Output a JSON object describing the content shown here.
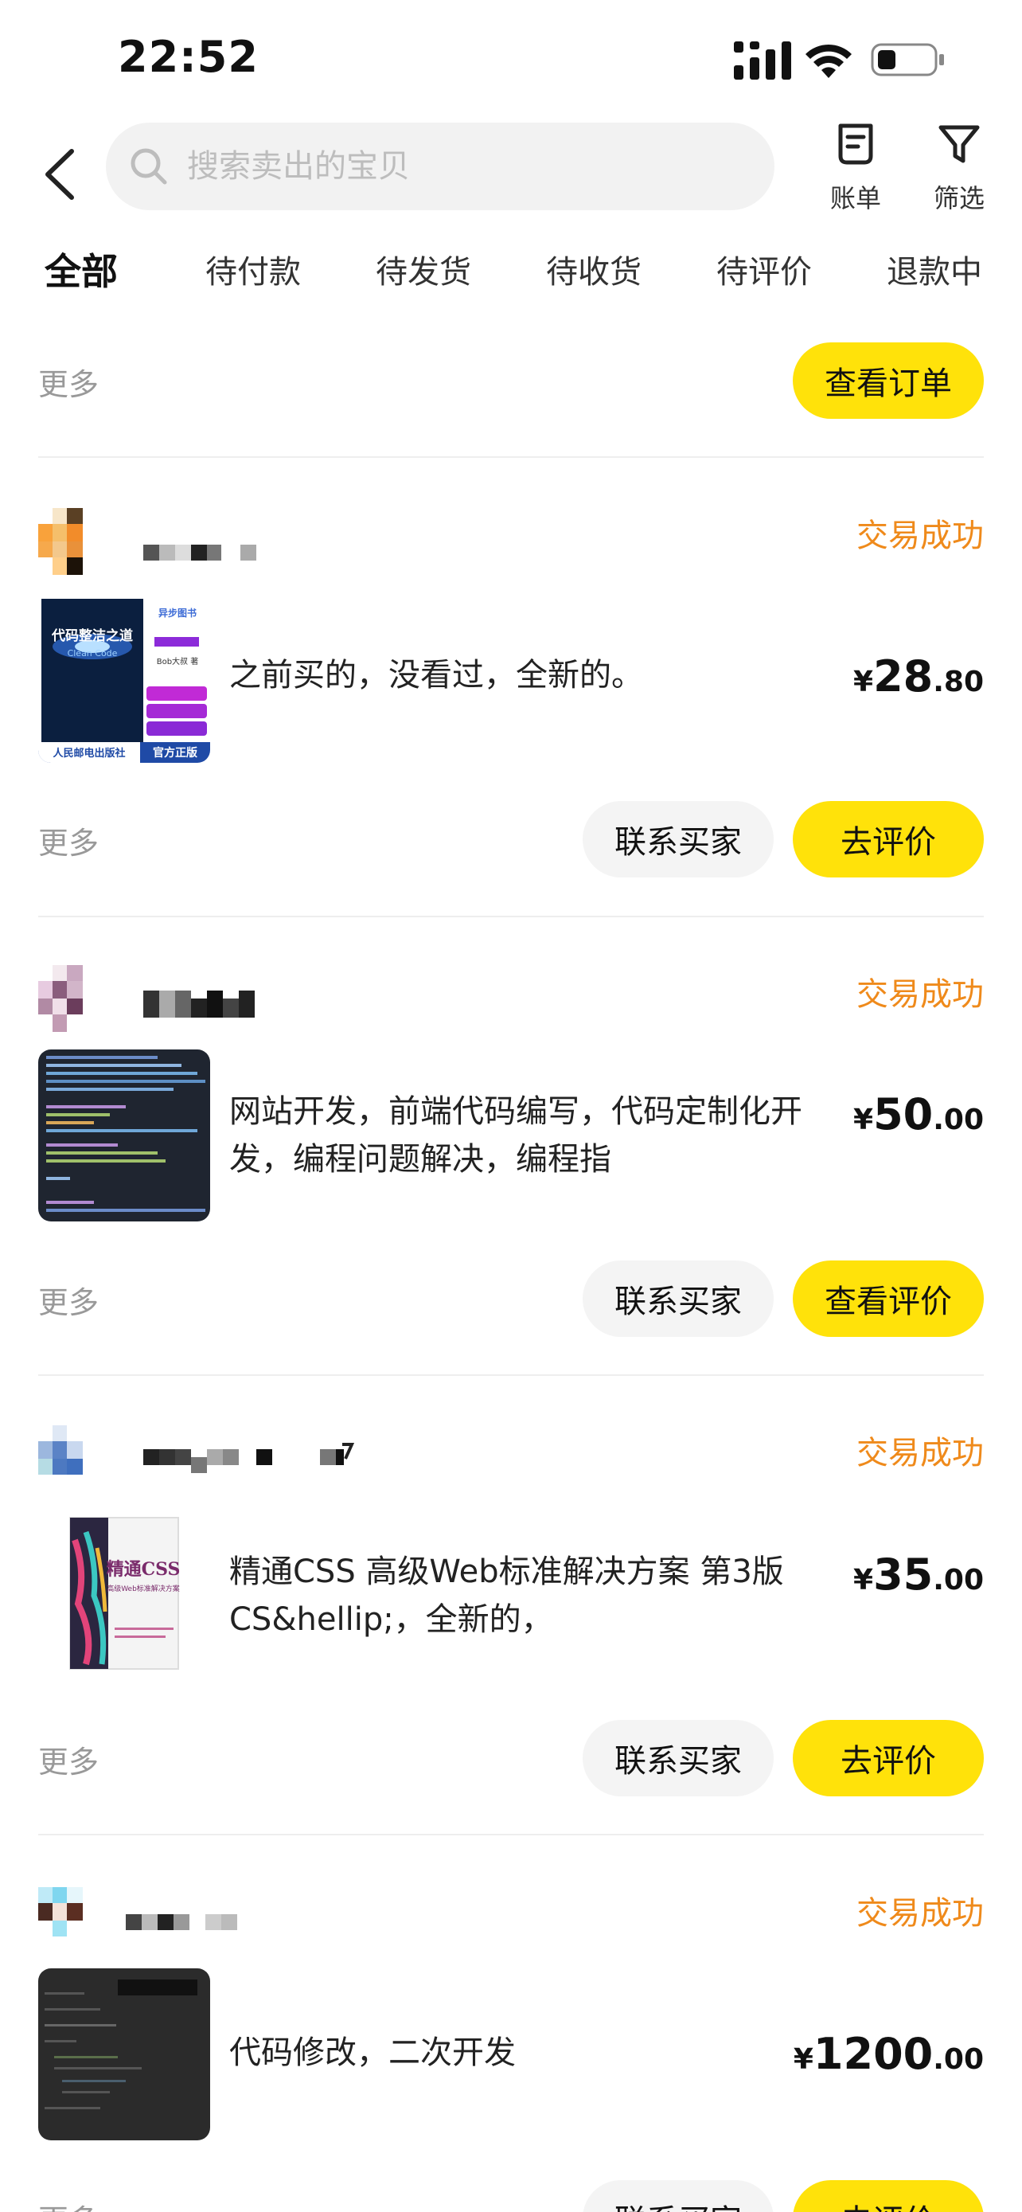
{
  "status_bar": {
    "time": "22:52"
  },
  "header": {
    "search_placeholder": "搜索卖出的宝贝",
    "bill_label": "账单",
    "filter_label": "筛选"
  },
  "tabs": [
    {
      "label": "全部",
      "active": true
    },
    {
      "label": "待付款"
    },
    {
      "label": "待发货"
    },
    {
      "label": "待收货"
    },
    {
      "label": "待评价"
    },
    {
      "label": "退款中"
    }
  ],
  "top_partial": {
    "more": "更多",
    "view_order": "查看订单"
  },
  "orders": [
    {
      "status": "交易成功",
      "title": "之前买的，没看过，全新的。",
      "price_int": "28",
      "price_dec": ".80",
      "more": "更多",
      "contact": "联系买家",
      "action": "去评价"
    },
    {
      "status": "交易成功",
      "title": "网站开发，前端代码编写，代码定制化开发，编程问题解决，编程指",
      "price_int": "50",
      "price_dec": ".00",
      "more": "更多",
      "contact": "联系买家",
      "action": "查看评价"
    },
    {
      "status": "交易成功",
      "title": "精通CSS 高级Web标准解决方案 第3版 CS&hellip;，全新的，",
      "price_int": "35",
      "price_dec": ".00",
      "more": "更多",
      "contact": "联系买家",
      "action": "去评价"
    },
    {
      "status": "交易成功",
      "title": "代码修改，二次开发",
      "price_int": "1200",
      "price_dec": ".00",
      "more": "更多",
      "contact": "联系买家",
      "action": "去评价"
    }
  ],
  "currency": "¥",
  "book1_cover": {
    "title": "代码整洁之道",
    "subtitle": "Clean Code",
    "publisher": "人民邮电出版社",
    "badge": "官方正版",
    "tag1": "异步图书",
    "tag2": "Bob大叔 著"
  },
  "book3_cover": {
    "title": "精通CSS",
    "subtitle": "高级Web标准解决方案"
  },
  "colors": {
    "accent": "#ffe20a",
    "status": "#ef8a1b",
    "muted": "#999999"
  }
}
